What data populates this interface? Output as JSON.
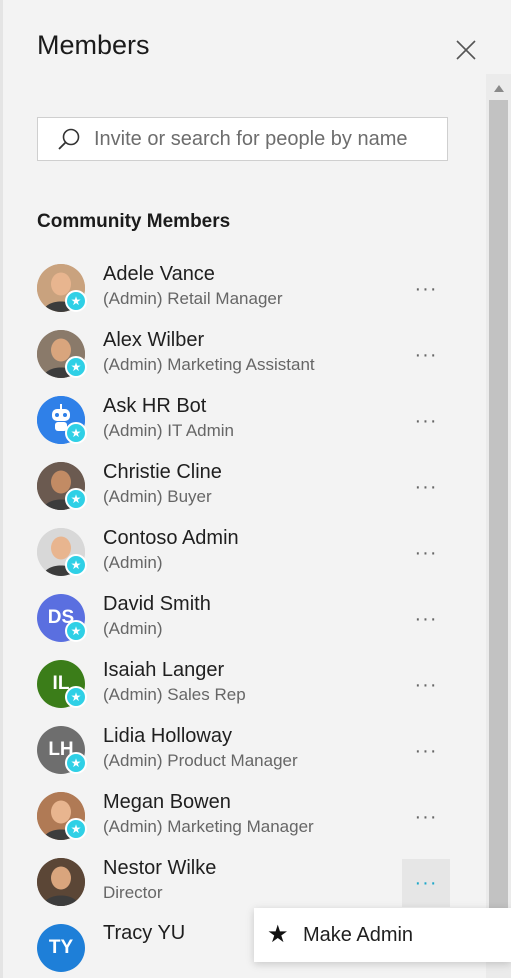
{
  "panel": {
    "title": "Members",
    "search_placeholder": "Invite or search for people by name",
    "section_title": "Community Members"
  },
  "members": [
    {
      "name": "Adele Vance",
      "role": "(Admin) Retail Manager",
      "admin": true,
      "avatar": "photo",
      "avatar_color": "#c9a27e",
      "initials": ""
    },
    {
      "name": "Alex Wilber",
      "role": "(Admin) Marketing Assistant",
      "admin": true,
      "avatar": "photo",
      "avatar_color": "#8a7a6a",
      "initials": ""
    },
    {
      "name": "Ask HR Bot",
      "role": "(Admin) IT Admin",
      "admin": true,
      "avatar": "bot-icon",
      "avatar_color": "#2f80e8",
      "initials": ""
    },
    {
      "name": "Christie Cline",
      "role": "(Admin) Buyer",
      "admin": true,
      "avatar": "photo",
      "avatar_color": "#6b5a50",
      "initials": ""
    },
    {
      "name": "Contoso Admin",
      "role": "(Admin)",
      "admin": true,
      "avatar": "photo",
      "avatar_color": "#d8d8d8",
      "initials": ""
    },
    {
      "name": "David Smith",
      "role": "(Admin)",
      "admin": true,
      "avatar": "initials",
      "avatar_color": "#5a6fe0",
      "initials": "DS"
    },
    {
      "name": "Isaiah Langer",
      "role": "(Admin) Sales Rep",
      "admin": true,
      "avatar": "initials",
      "avatar_color": "#3b7d19",
      "initials": "IL"
    },
    {
      "name": "Lidia Holloway",
      "role": "(Admin) Product Manager",
      "admin": true,
      "avatar": "initials",
      "avatar_color": "#6e6e6e",
      "initials": "LH"
    },
    {
      "name": "Megan Bowen",
      "role": "(Admin) Marketing Manager",
      "admin": true,
      "avatar": "photo",
      "avatar_color": "#b07a55",
      "initials": ""
    },
    {
      "name": "Nestor Wilke",
      "role": "Director",
      "admin": false,
      "avatar": "photo",
      "avatar_color": "#5b4636",
      "initials": ""
    },
    {
      "name": "Tracy YU",
      "role": "",
      "admin": false,
      "avatar": "initials",
      "avatar_color": "#1e7fd8",
      "initials": "TY"
    }
  ],
  "more_button": {
    "label": "···"
  },
  "context_menu": {
    "make_admin_label": "Make Admin",
    "icon": "star-icon"
  },
  "colors": {
    "admin_badge": "#2fd0e6",
    "active_more": "#1fa8c9",
    "background": "#f3f3f3"
  }
}
